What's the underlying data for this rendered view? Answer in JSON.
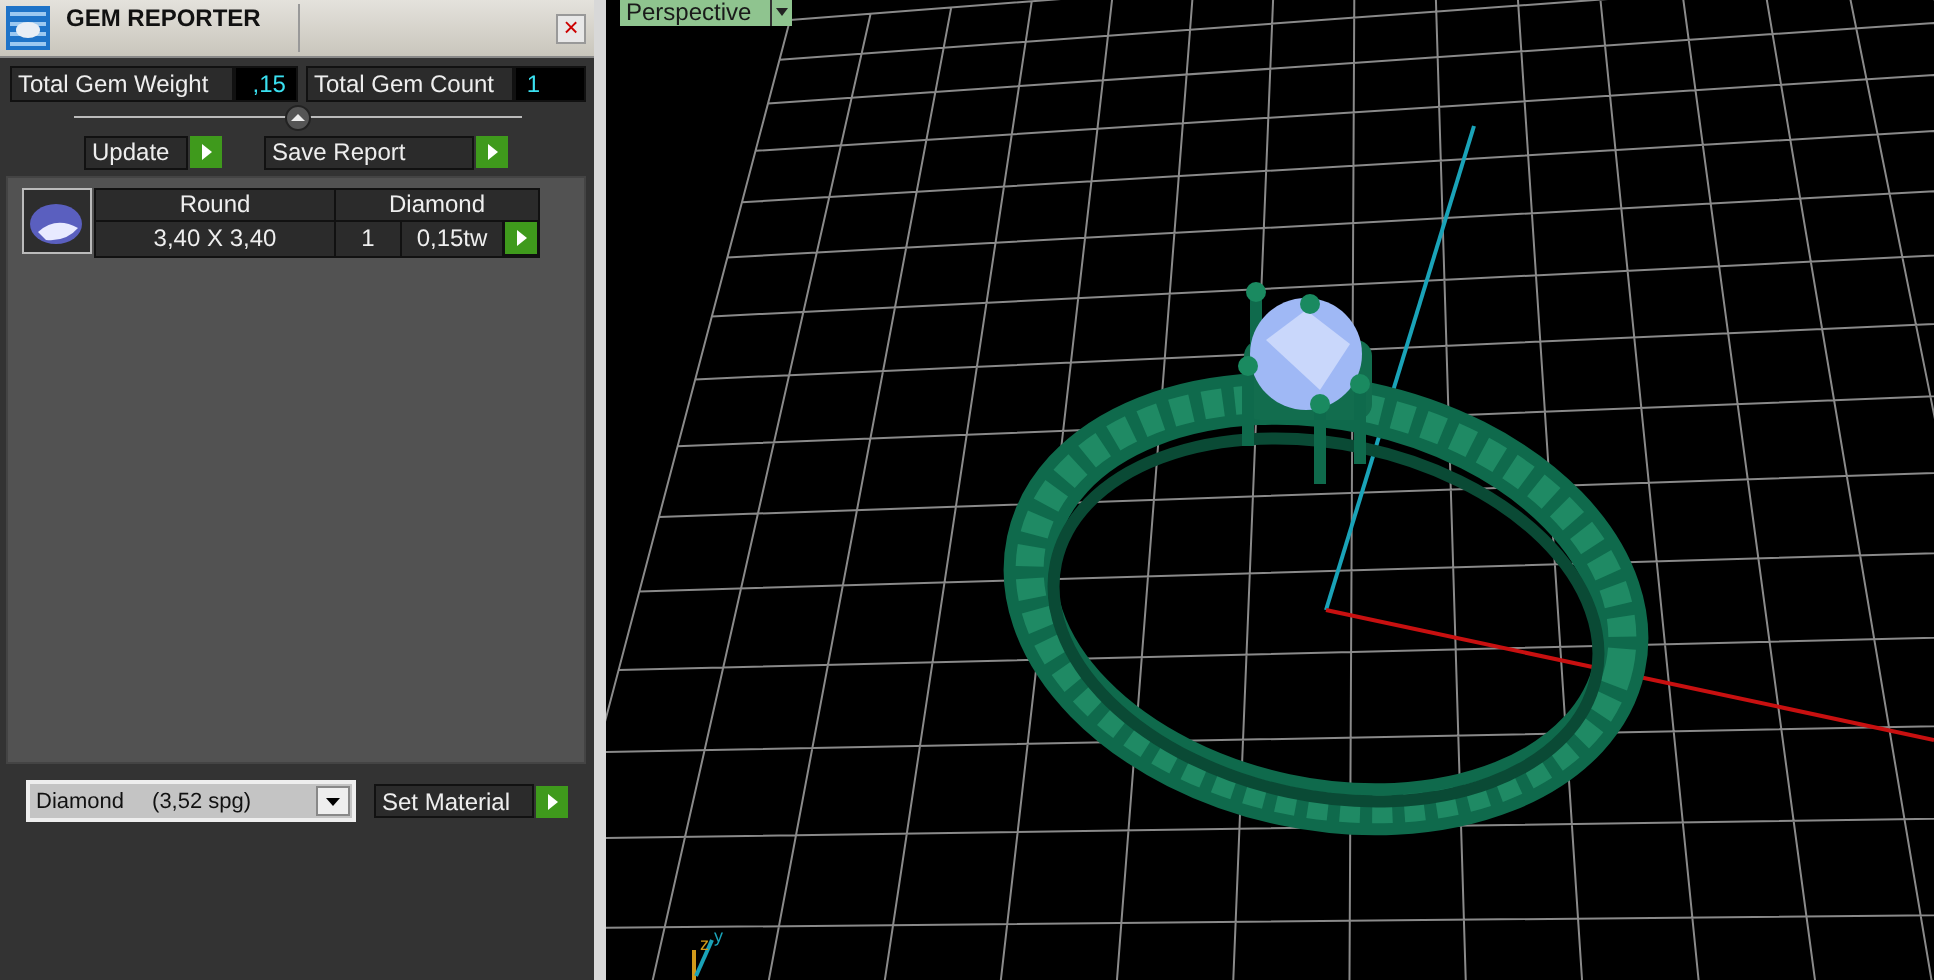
{
  "panel": {
    "title": "GEM REPORTER",
    "close": "×"
  },
  "stats": [
    {
      "label": "Total Gem Weight",
      "value": ",15"
    },
    {
      "label": "Total Gem Count",
      "value": "1"
    }
  ],
  "actions": [
    {
      "label": "Update"
    },
    {
      "label": "Save Report"
    }
  ],
  "gems": [
    {
      "shape": "Round",
      "material": "Diamond",
      "size": "3,40 X 3,40",
      "count": "1",
      "weight": "0,15tw"
    }
  ],
  "material_select": {
    "value": "Diamond",
    "density": "(3,52 spg)"
  },
  "set_material": {
    "label": "Set Material"
  },
  "viewport": {
    "view": "Perspective",
    "axis_labels": [
      "z",
      "y"
    ]
  }
}
